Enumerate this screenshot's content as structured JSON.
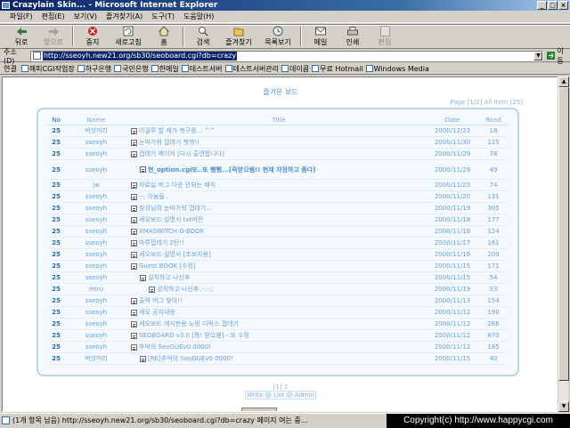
{
  "window": {
    "title": "Crazylain Skin... - Microsoft Internet Explorer",
    "buttons": [
      "_",
      "□",
      "×"
    ]
  },
  "menu": [
    "파일(F)",
    "편집(E)",
    "보기(V)",
    "즐겨찾기(A)",
    "도구(T)",
    "도움말(H)"
  ],
  "toolbar": {
    "back": "뒤로",
    "forward": "앞으로",
    "stop": "중지",
    "refresh": "새로고침",
    "home": "홈",
    "search": "검색",
    "favorites": "즐겨찾기",
    "history": "목록보기",
    "mail": "메일",
    "print": "인쇄",
    "edit": "편집"
  },
  "address": {
    "label": "주소(D)",
    "url": "http://sseoyh.new21.org/sb30/seoboard.cgi?db=crazy",
    "go": "이동"
  },
  "links": {
    "label": "연결",
    "items": [
      "해피CGI작업장",
      "하구은행",
      "국민은행",
      "한메일",
      "테스트서버",
      "테스트서버관리",
      "데이콤",
      "무료 Hotmail",
      "Windows Media"
    ]
  },
  "board": {
    "title": "즐거운 보드",
    "page_info": "Page [1/2] All Item [25]",
    "headers": {
      "no": "No",
      "name": "Name",
      "title": "Title",
      "date": "Date",
      "read": "Read"
    },
    "rows": [
      {
        "no": "25",
        "name": "버섯머리",
        "title": "이걸루 할 제가 복구를... ^^",
        "date": "2000/12/23",
        "read": "18",
        "indent": 0
      },
      {
        "no": "25",
        "name": "sseoyh",
        "title": "눈따가워 껍데기 쳇쳇!!",
        "date": "2000/11/30",
        "read": "125",
        "indent": 0
      },
      {
        "no": "25",
        "name": "sseoyh",
        "title": "껍데기 메이커 [다시 출연합니다]",
        "date": "2000/11/29",
        "read": "78",
        "indent": 0
      },
      {
        "no": "25",
        "name": "sseoyh",
        "title": "현_option.cgi또..또 뻥뻥...[즉받으쌤!! 현재 자정하고 좀다]",
        "date": "2000/11/29",
        "read": "49",
        "indent": 1,
        "tall": true,
        "bold": true
      },
      {
        "no": "25",
        "name": "jw",
        "title": "자료실 버그 다운 안되는 패치",
        "date": "2000/11/25",
        "read": "74",
        "indent": 0
      },
      {
        "no": "25",
        "name": "sseoyh",
        "title": "--; 이놈들..",
        "date": "2000/11/20",
        "read": "131",
        "indent": 0
      },
      {
        "no": "25",
        "name": "sseoyh",
        "title": "창쉬님의 눈따가워 껍데기...",
        "date": "2000/11/19",
        "read": "305",
        "indent": 0
      },
      {
        "no": "25",
        "name": "sseoyh",
        "title": "세오보드 설명서 txt버전",
        "date": "2000/11/18",
        "read": "177",
        "indent": 0
      },
      {
        "no": "25",
        "name": "sseoyh",
        "title": "XMASWITCH G-BOOK",
        "date": "2000/11/18",
        "read": "124",
        "indent": 0
      },
      {
        "no": "25",
        "name": "sseoyh",
        "title": "마루껍데기 2탄!!",
        "date": "2000/11/17",
        "read": "161",
        "indent": 0
      },
      {
        "no": "25",
        "name": "sseoyh",
        "title": "세오보드 설명서 [초보자용]",
        "date": "2000/11/16",
        "read": "209",
        "indent": 0
      },
      {
        "no": "25",
        "name": "sseoyh",
        "title": "Guest BOOK [수정]",
        "date": "2000/11/15",
        "read": "171",
        "indent": 0
      },
      {
        "no": "25",
        "name": "sseoyh",
        "title": "설치하고 나신후",
        "date": "2000/11/15",
        "read": "54",
        "indent": 1
      },
      {
        "no": "25",
        "name": "miru",
        "title": "설치하고 나신후..-.-;;",
        "date": "2000/11/19",
        "read": "33",
        "indent": 2
      },
      {
        "no": "25",
        "name": "sseoyh",
        "title": "출력 버그 찾아!!",
        "date": "2000/11/13",
        "read": "154",
        "indent": 0
      },
      {
        "no": "25",
        "name": "sseoyh",
        "title": "세오 공지내용",
        "date": "2000/11/12",
        "read": "190",
        "indent": 0
      },
      {
        "no": "25",
        "name": "sseoyh",
        "title": "세오보드 게시판용 노랑 디럭스 껍데기",
        "date": "2000/11/12",
        "read": "266",
        "indent": 0
      },
      {
        "no": "25",
        "name": "sseoyh",
        "title": "SEOBOARD v3.0 [폭! 받으쌤] - 또 수정",
        "date": "2000/11/12",
        "read": "870",
        "indent": 0
      },
      {
        "no": "25",
        "name": "sseoyh",
        "title": "추억의 SeoGUEv0.0000!",
        "date": "2000/11/12",
        "read": "185",
        "indent": 0
      },
      {
        "no": "25",
        "name": "버섯머리",
        "title": "[RE]추억의 SeoGUEv0.0000!",
        "date": "2000/11/15",
        "read": "40",
        "indent": 1
      }
    ],
    "pager": "[1] 2",
    "actions": "Write @ List @ Admin"
  },
  "status": {
    "text": "(1개 항목 남음) http://sseoyh.new21.org/sb30/seoboard.cgi?db=crazy 페이지 여는 중..."
  },
  "copyright": "Copyright(c) http://www.happycgi.com",
  "colors": {
    "title_gradient_start": "#0a246a",
    "board_text": "#6aa0d6",
    "board_border": "#b8d3ec"
  }
}
